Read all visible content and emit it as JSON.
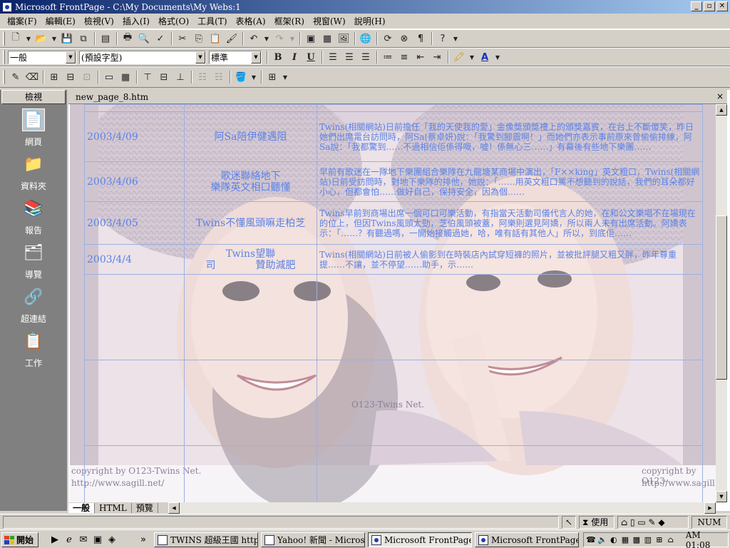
{
  "window": {
    "title": "Microsoft FrontPage - C:\\My Documents\\My Webs:1",
    "controls": [
      "_",
      "▫",
      "✕"
    ]
  },
  "menu": [
    "檔案(F)",
    "編輯(E)",
    "檢視(V)",
    "插入(I)",
    "格式(O)",
    "工具(T)",
    "表格(A)",
    "框架(R)",
    "視窗(W)",
    "說明(H)"
  ],
  "format_toolbar": {
    "style": "一般",
    "font": "(預設字型)",
    "size": "標準",
    "bold": "B",
    "italic": "I",
    "underline": "U"
  },
  "views": {
    "header": "檢視",
    "items": [
      {
        "label": "網頁",
        "icon": "page-icon"
      },
      {
        "label": "資料夾",
        "icon": "folder-icon"
      },
      {
        "label": "報告",
        "icon": "reports-icon"
      },
      {
        "label": "導覽",
        "icon": "navigation-icon"
      },
      {
        "label": "超連結",
        "icon": "hyperlinks-icon"
      },
      {
        "label": "工作",
        "icon": "tasks-icon"
      }
    ]
  },
  "document": {
    "filename": "new_page_8.htm",
    "close": "×"
  },
  "news_rows": [
    {
      "date": "2003/4/09",
      "title": "阿Sa陪伊健遇阻",
      "body": "Twins(相關網站)日前擔任「我的天使我的愛」金像獎頒獎禮上的頒獎嘉賓，在台上不斷傻笑，昨日她們出席電台訪問時，阿Sa(蔡卓妍)說：「我驚到腳震啊！」而她們亦表示事前原來曾偷偷排練，阿Sa說：「我都驚到……不過相信佢係得嘅，噓！係無心三……」有幕後有些地下樂團……"
    },
    {
      "date": "2003/4/06",
      "title": "歌迷聯絡地下\n樂隊英文相口聽懂",
      "body": "早前有歌迷在一隊地下樂團組合樂隊在九龍塘某商場中演出，「F××king」英文粗口，Twins(相關網站)日前受訪問時，對地下樂隊的排他，她說：「……用英文粗口罵不想聽到的說話，我們的耳朵都好小心，但都會怕……做好自己，保持安全，因為個……"
    },
    {
      "date": "2003/4/05",
      "title": "Twins不懂風頭嘛走柏芝",
      "body": "Twins早前到商場出席一個可口可樂活動，有指當天活動司儀代言人的她，在和公文樂唱不在場現在的位上，但因Twins風頭太勁，芝伯風頭被蓋，阿樂則選見阿嬌，所以兩人未有出席活動。阿嬌表示：「……？有聽過嗎，一開始接觸過她，哈，唯有話有其他人」所以，到底佢……"
    },
    {
      "date": "2003/4/4",
      "title": "Twins望聯\n司　　　　贊助減肥",
      "body": "Twins(相關網站)日前被人偷影到在時裝店內試穿短褲的照片，並被批評腿又粗又胖，昨年尊重提……不讓，並不停望……助手，示……"
    }
  ],
  "watermark": {
    "center": "O123-Twins Net.",
    "left_line1": "copyright by O123-Twins Net.",
    "left_line2": "http://www.sagill.net/",
    "right_line1": "copyright by O123-",
    "right_line2": "http://www.sagill.n"
  },
  "view_tabs": [
    "一般",
    "HTML",
    "預覽"
  ],
  "statusbar": {
    "progress": "使用 2"
  },
  "taskbar": {
    "start": "開始",
    "tasks": [
      {
        "label": "TWINS 超級王國 http:..."
      },
      {
        "label": "Yahoo! 新聞 - Microso..."
      },
      {
        "label": "Microsoft FrontPage - ..."
      },
      {
        "label": "Microsoft FrontPage - ..."
      }
    ],
    "clock": "AM 01:08"
  },
  "colors": {
    "title_active": "#0a246a",
    "link_blue": "#5b82e6",
    "chrome": "#d4d0c8"
  }
}
